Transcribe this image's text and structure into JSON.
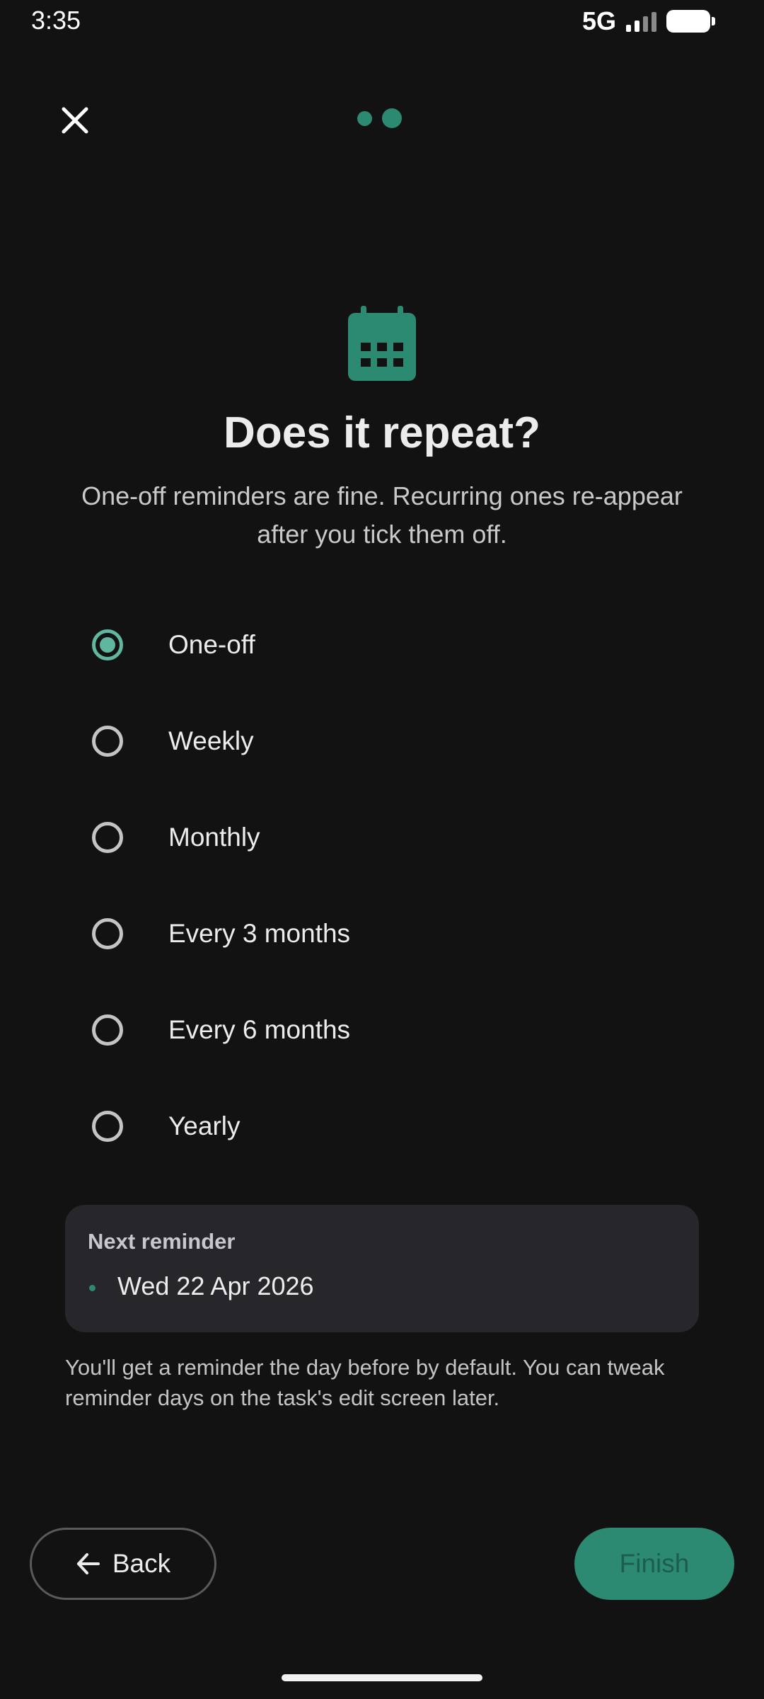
{
  "status_bar": {
    "time": "3:35",
    "network": "5G",
    "signal_icon": "signal-bars-icon",
    "battery_icon": "battery-full-icon"
  },
  "header": {
    "close_icon": "close-icon",
    "step_indicator": {
      "total_steps": 2,
      "current_step": 2
    }
  },
  "hero": {
    "icon": "calendar-icon",
    "title": "Does it repeat?",
    "subtitle": "One-off reminders are fine. Recurring ones re-appear after you tick them off."
  },
  "options": {
    "selected": "One-off",
    "items": [
      {
        "label": "One-off",
        "checked": true
      },
      {
        "label": "Weekly",
        "checked": false
      },
      {
        "label": "Monthly",
        "checked": false
      },
      {
        "label": "Every 3 months",
        "checked": false
      },
      {
        "label": "Every 6 months",
        "checked": false
      },
      {
        "label": "Yearly",
        "checked": false
      }
    ]
  },
  "next_reminder": {
    "heading": "Next reminder",
    "date": "Wed 22 Apr 2026"
  },
  "note": "You'll get a reminder the day before by default. You can tweak reminder days on the task's edit screen later.",
  "footer": {
    "back_label": "Back",
    "back_icon": "arrow-left-icon",
    "finish_label": "Finish"
  },
  "colors": {
    "background": "#121212",
    "accent": "#2c8a72",
    "radio_checked": "#5fb7a0",
    "card_background": "#27272b",
    "finish_text": "#1c5e4d"
  }
}
